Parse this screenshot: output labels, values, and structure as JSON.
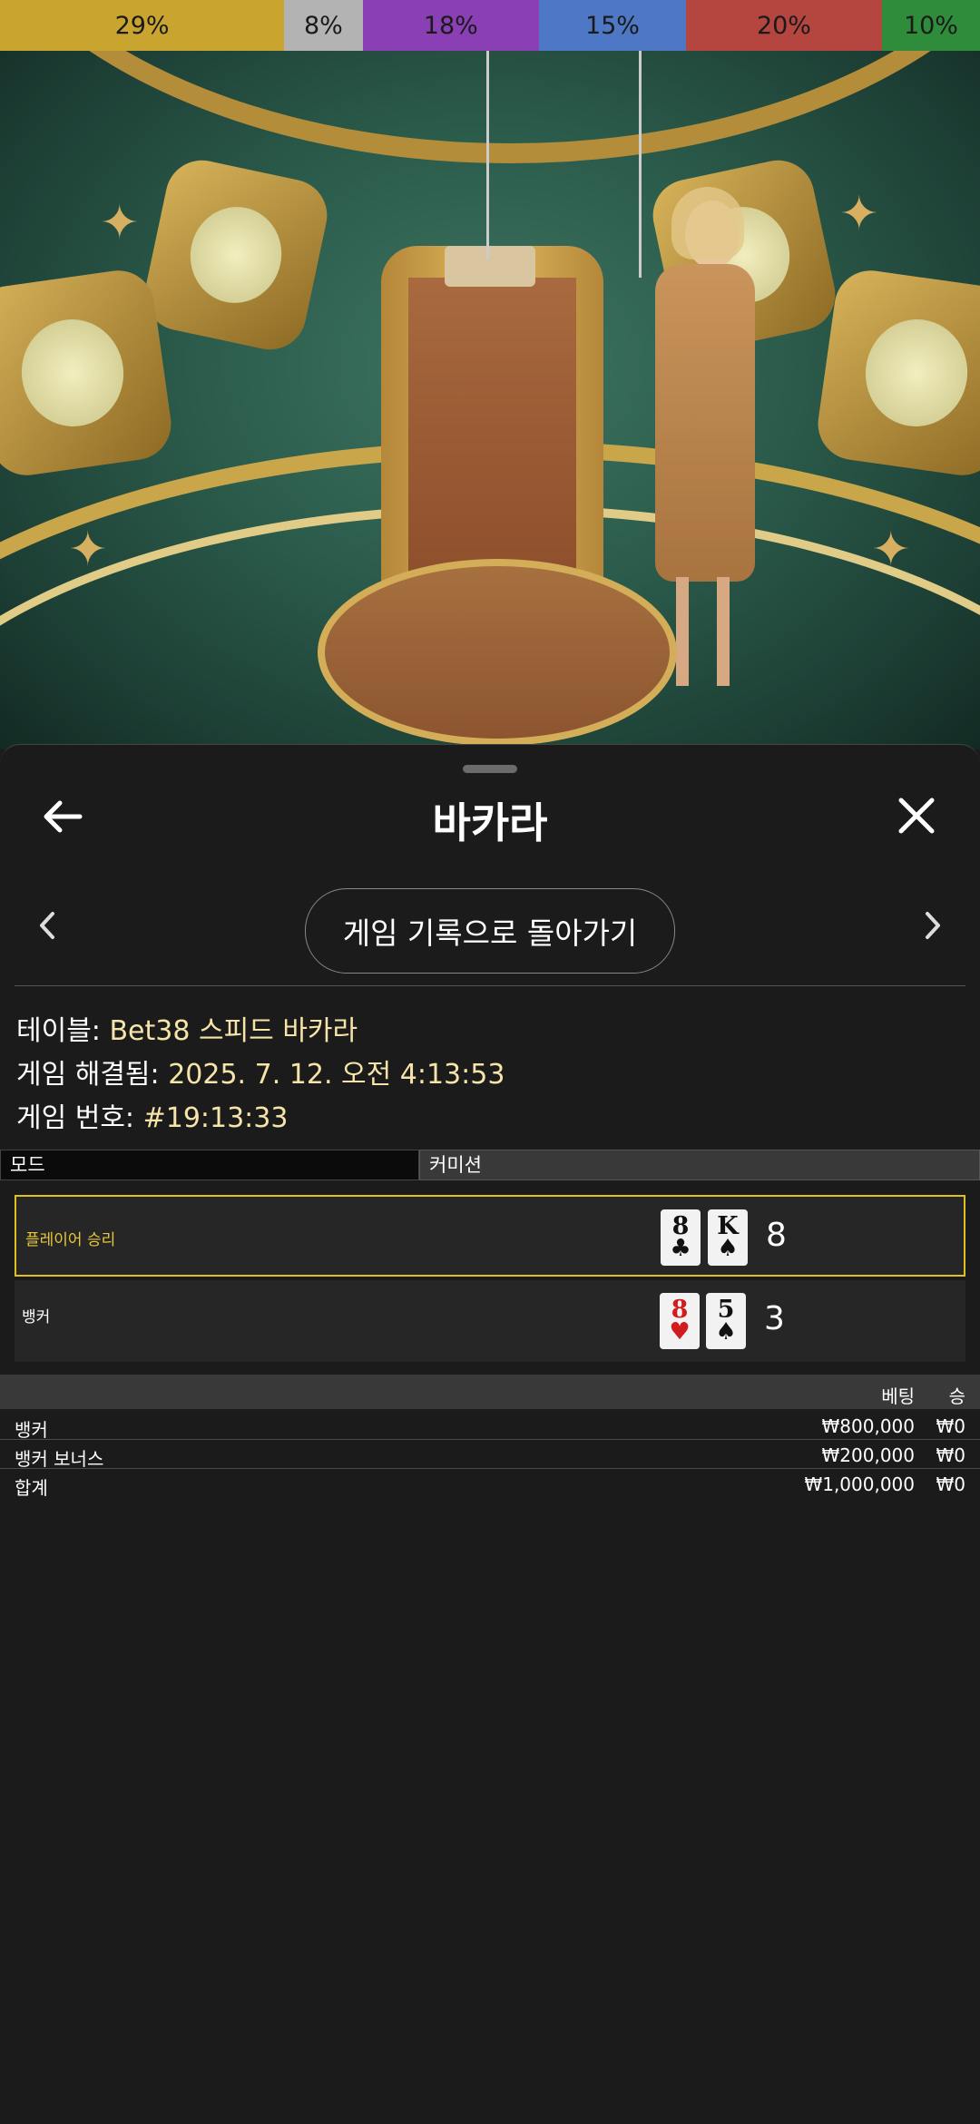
{
  "distribution": [
    {
      "label": "29%",
      "value": 29,
      "color": "#c9a530"
    },
    {
      "label": "8%",
      "value": 8,
      "color": "#b3b3b3"
    },
    {
      "label": "18%",
      "value": 18,
      "color": "#8a3fb4"
    },
    {
      "label": "15%",
      "value": 15,
      "color": "#4e78c6"
    },
    {
      "label": "20%",
      "value": 20,
      "color": "#b4453f"
    },
    {
      "label": "10%",
      "value": 10,
      "color": "#2f8c3a"
    }
  ],
  "panel": {
    "title": "바카라",
    "back_to_history": "게임 기록으로 돌아가기",
    "icons": {
      "back": "arrow-left-icon",
      "close": "close-icon",
      "prev": "chevron-left-icon",
      "next": "chevron-right-icon"
    }
  },
  "info": {
    "table_label": "테이블:",
    "table_value": "Bet38 스피드 바카라",
    "resolved_label": "게임 해결됨:",
    "resolved_value": "2025. 7. 12. 오전 4:13:53",
    "number_label": "게임 번호:",
    "number_value": "#19:13:33"
  },
  "mode": {
    "mode_label": "모드",
    "commission_label": "커미션"
  },
  "results": {
    "player": {
      "label": "플레이어 승리",
      "cards": [
        {
          "rank": "8",
          "suit": "♣",
          "color": "black"
        },
        {
          "rank": "K",
          "suit": "♠",
          "color": "black"
        }
      ],
      "score": "8"
    },
    "banker": {
      "label": "뱅커",
      "cards": [
        {
          "rank": "8",
          "suit": "♥",
          "color": "red"
        },
        {
          "rank": "5",
          "suit": "♠",
          "color": "black"
        }
      ],
      "score": "3"
    }
  },
  "bets": {
    "header": {
      "bet": "베팅",
      "win": "승"
    },
    "rows": [
      {
        "name": "뱅커",
        "bet": "₩800,000",
        "win": "₩0"
      },
      {
        "name": "뱅커 보너스",
        "bet": "₩200,000",
        "win": "₩0"
      },
      {
        "name": "합계",
        "bet": "₩1,000,000",
        "win": "₩0"
      }
    ]
  }
}
